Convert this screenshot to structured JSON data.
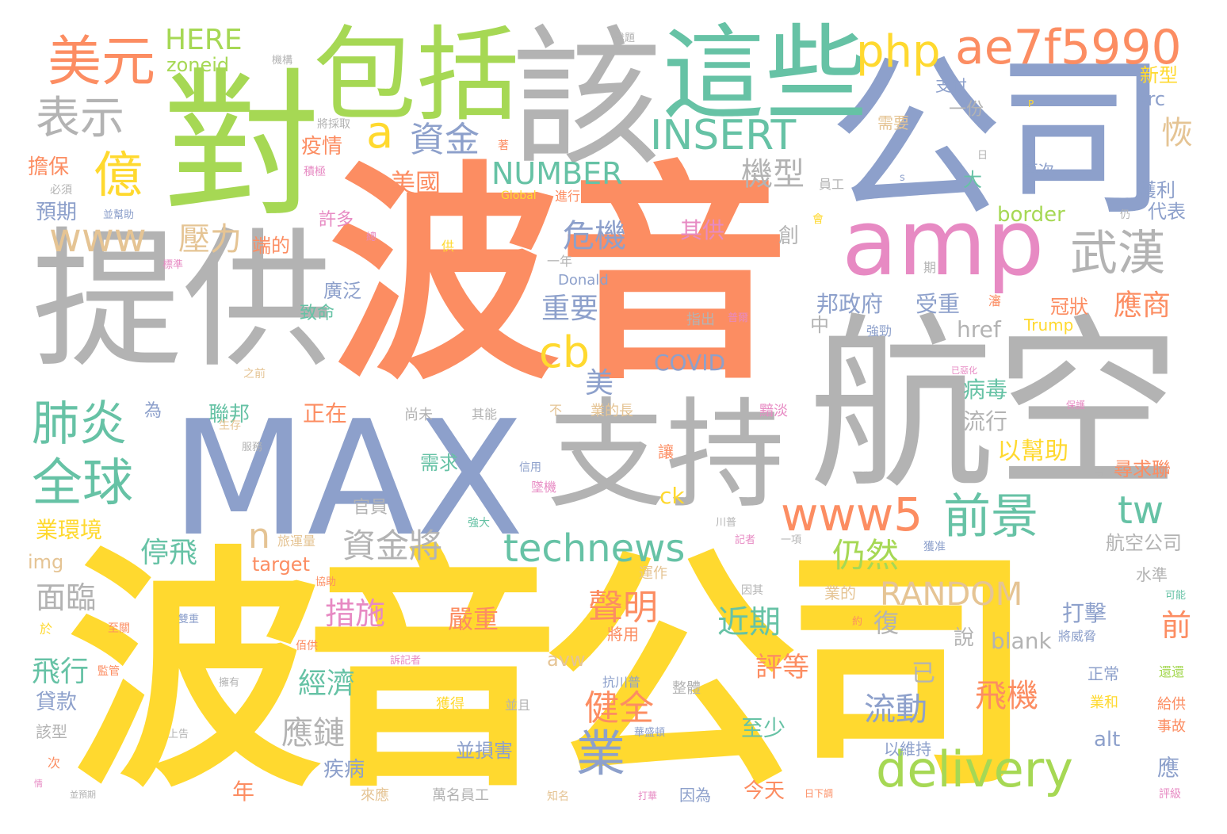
{
  "words": [
    {
      "text": "波音",
      "color": "#fc8d62"
    },
    {
      "text": "波音公司",
      "color": "#ffd92f"
    },
    {
      "text": "MAX",
      "color": "#8da0cb"
    },
    {
      "text": "航空",
      "color": "#b3b3b3"
    },
    {
      "text": "公司",
      "color": "#8da0cb"
    },
    {
      "text": "提供",
      "color": "#b3b3b3"
    },
    {
      "text": "支持",
      "color": "#b3b3b3"
    },
    {
      "text": "對",
      "color": "#a6d854"
    },
    {
      "text": "該",
      "color": "#b3b3b3"
    },
    {
      "text": "這些",
      "color": "#66c2a5"
    },
    {
      "text": "包括",
      "color": "#a6d854"
    },
    {
      "text": "amp",
      "color": "#e78ac3"
    },
    {
      "text": "美元",
      "color": "#fc8d62"
    },
    {
      "text": "php",
      "color": "#ffd92f"
    },
    {
      "text": "ae7f5990",
      "color": "#fc8d62"
    },
    {
      "text": "HERE",
      "color": "#a6d854"
    },
    {
      "text": "zoneid",
      "color": "#a6d854"
    },
    {
      "text": "表示",
      "color": "#b3b3b3"
    },
    {
      "text": "億",
      "color": "#ffd92f"
    },
    {
      "text": "a",
      "color": "#ffd92f"
    },
    {
      "text": "資金",
      "color": "#8da0cb"
    },
    {
      "text": "INSERT",
      "color": "#66c2a5"
    },
    {
      "text": "NUMBER",
      "color": "#66c2a5"
    },
    {
      "text": "機型",
      "color": "#b3b3b3"
    },
    {
      "text": "武漢",
      "color": "#b3b3b3"
    },
    {
      "text": "www",
      "color": "#e5c494"
    },
    {
      "text": "壓力",
      "color": "#e5c494"
    },
    {
      "text": "危機",
      "color": "#8da0cb"
    },
    {
      "text": "肺炎",
      "color": "#66c2a5"
    },
    {
      "text": "全球",
      "color": "#66c2a5"
    },
    {
      "text": "cb",
      "color": "#ffd92f"
    },
    {
      "text": "重要",
      "color": "#8da0cb"
    },
    {
      "text": "美國",
      "color": "#fc8d62"
    },
    {
      "text": "疫情",
      "color": "#fc8d62"
    },
    {
      "text": "www5",
      "color": "#fc8d62"
    },
    {
      "text": "前景",
      "color": "#66c2a5"
    },
    {
      "text": "tw",
      "color": "#66c2a5"
    },
    {
      "text": "technews",
      "color": "#66c2a5"
    },
    {
      "text": "n",
      "color": "#e5c494"
    },
    {
      "text": "資金將",
      "color": "#b3b3b3"
    },
    {
      "text": "停飛",
      "color": "#66c2a5"
    },
    {
      "text": "仍然",
      "color": "#a6d854"
    },
    {
      "text": "RANDOM",
      "color": "#e5c494"
    },
    {
      "text": "delivery",
      "color": "#a6d854"
    },
    {
      "text": "業",
      "color": "#8da0cb"
    },
    {
      "text": "聲明",
      "color": "#fc8d62"
    },
    {
      "text": "措施",
      "color": "#e78ac3"
    },
    {
      "text": "面臨",
      "color": "#b3b3b3"
    },
    {
      "text": "近期",
      "color": "#66c2a5"
    },
    {
      "text": "經濟",
      "color": "#66c2a5"
    },
    {
      "text": "飛機",
      "color": "#fc8d62"
    },
    {
      "text": "健全",
      "color": "#fc8d62"
    },
    {
      "text": "流動",
      "color": "#8da0cb"
    },
    {
      "text": "應鏈",
      "color": "#b3b3b3"
    },
    {
      "text": "飛行",
      "color": "#66c2a5"
    },
    {
      "text": "評等",
      "color": "#fc8d62"
    },
    {
      "text": "COVID",
      "color": "#8da0cb"
    },
    {
      "text": "應商",
      "color": "#fc8d62"
    },
    {
      "text": "邦政府",
      "color": "#8da0cb"
    },
    {
      "text": "受重",
      "color": "#8da0cb"
    },
    {
      "text": "href",
      "color": "#b3b3b3"
    },
    {
      "text": "以幫助",
      "color": "#ffd92f"
    },
    {
      "text": "病毒",
      "color": "#66c2a5"
    },
    {
      "text": "流行",
      "color": "#b3b3b3"
    },
    {
      "text": "打擊",
      "color": "#8da0cb"
    },
    {
      "text": "blank",
      "color": "#b3b3b3"
    },
    {
      "text": "嚴重",
      "color": "#fc8d62"
    },
    {
      "text": "target",
      "color": "#fc8d62"
    },
    {
      "text": "img",
      "color": "#e5c494"
    },
    {
      "text": "航空公司",
      "color": "#b3b3b3"
    },
    {
      "text": "border",
      "color": "#a6d854"
    },
    {
      "text": "獲利",
      "color": "#8da0cb"
    },
    {
      "text": "代表",
      "color": "#8da0cb"
    },
    {
      "text": "src",
      "color": "#8da0cb"
    },
    {
      "text": "新型",
      "color": "#ffd92f"
    },
    {
      "text": "支付",
      "color": "#8da0cb"
    },
    {
      "text": "一份",
      "color": "#b3b3b3"
    },
    {
      "text": "需要",
      "color": "#e5c494"
    },
    {
      "text": "再次",
      "color": "#8da0cb"
    },
    {
      "text": "其供",
      "color": "#e78ac3"
    },
    {
      "text": "擔保",
      "color": "#fc8d62"
    },
    {
      "text": "預期",
      "color": "#8da0cb"
    },
    {
      "text": "貸款",
      "color": "#8da0cb"
    },
    {
      "text": "至少",
      "color": "#66c2a5"
    },
    {
      "text": "今天",
      "color": "#fc8d62"
    },
    {
      "text": "並損害",
      "color": "#8da0cb"
    },
    {
      "text": "疾病",
      "color": "#8da0cb"
    },
    {
      "text": "年",
      "color": "#fc8d62"
    },
    {
      "text": "業環境",
      "color": "#ffd92f"
    },
    {
      "text": "官員",
      "color": "#b3b3b3"
    },
    {
      "text": "正在",
      "color": "#fc8d62"
    },
    {
      "text": "聯邦",
      "color": "#66c2a5"
    },
    {
      "text": "需求",
      "color": "#66c2a5"
    },
    {
      "text": "廣泛",
      "color": "#8da0cb"
    },
    {
      "text": "致命",
      "color": "#66c2a5"
    },
    {
      "text": "許多",
      "color": "#e78ac3"
    },
    {
      "text": "端的",
      "color": "#fc8d62"
    },
    {
      "text": "alt",
      "color": "#8da0cb"
    },
    {
      "text": "以維持",
      "color": "#8da0cb"
    },
    {
      "text": "尋求聯",
      "color": "#fc8d62"
    },
    {
      "text": "冠狀",
      "color": "#fc8d62"
    },
    {
      "text": "Trump",
      "color": "#ffd92f"
    },
    {
      "text": "Donald",
      "color": "#8da0cb"
    },
    {
      "text": "ck",
      "color": "#ffd92f"
    },
    {
      "text": "avw",
      "color": "#e5c494"
    },
    {
      "text": "說",
      "color": "#b3b3b3"
    },
    {
      "text": "已",
      "color": "#b3b3b3"
    },
    {
      "text": "復",
      "color": "#b3b3b3"
    },
    {
      "text": "美",
      "color": "#8da0cb"
    },
    {
      "text": "恢",
      "color": "#e5c494"
    },
    {
      "text": "創",
      "color": "#b3b3b3"
    },
    {
      "text": "中",
      "color": "#b3b3b3"
    },
    {
      "text": "大",
      "color": "#66c2a5"
    },
    {
      "text": "前",
      "color": "#fc8d62"
    },
    {
      "text": "應",
      "color": "#8da0cb"
    },
    {
      "text": "為",
      "color": "#8da0cb"
    },
    {
      "text": "因為",
      "color": "#8da0cb"
    },
    {
      "text": "來應",
      "color": "#e5c494"
    },
    {
      "text": "萬名員工",
      "color": "#b3b3b3"
    },
    {
      "text": "將用",
      "color": "#fc8d62"
    },
    {
      "text": "獲得",
      "color": "#ffd92f"
    },
    {
      "text": "並且",
      "color": "#b3b3b3"
    },
    {
      "text": "整體",
      "color": "#b3b3b3"
    },
    {
      "text": "運作",
      "color": "#e5c494"
    },
    {
      "text": "業的",
      "color": "#e5c494"
    },
    {
      "text": "水準",
      "color": "#b3b3b3"
    },
    {
      "text": "正常",
      "color": "#8da0cb"
    },
    {
      "text": "給供",
      "color": "#fc8d62"
    },
    {
      "text": "事故",
      "color": "#fc8d62"
    },
    {
      "text": "業和",
      "color": "#ffd92f"
    },
    {
      "text": "將威脅",
      "color": "#8da0cb"
    },
    {
      "text": "可能",
      "color": "#66c2a5"
    },
    {
      "text": "還還",
      "color": "#a6d854"
    },
    {
      "text": "評級",
      "color": "#e78ac3"
    },
    {
      "text": "Global",
      "color": "#ffd92f"
    },
    {
      "text": "進行",
      "color": "#fc8d62"
    },
    {
      "text": "員工",
      "color": "#b3b3b3"
    },
    {
      "text": "必須",
      "color": "#b3b3b3"
    },
    {
      "text": "並幫助",
      "color": "#8da0cb"
    },
    {
      "text": "積極",
      "color": "#e78ac3"
    },
    {
      "text": "將採取",
      "color": "#b3b3b3"
    },
    {
      "text": "標準",
      "color": "#e78ac3"
    },
    {
      "text": "一年",
      "color": "#b3b3b3"
    },
    {
      "text": "指出",
      "color": "#b3b3b3"
    },
    {
      "text": "普爾",
      "color": "#e78ac3"
    },
    {
      "text": "強勁",
      "color": "#8da0cb"
    },
    {
      "text": "難題",
      "color": "#b3b3b3"
    },
    {
      "text": "機構",
      "color": "#b3b3b3"
    },
    {
      "text": "尚未",
      "color": "#b3b3b3"
    },
    {
      "text": "其能",
      "color": "#b3b3b3"
    },
    {
      "text": "業的長",
      "color": "#e5c494"
    },
    {
      "text": "黯淡",
      "color": "#e78ac3"
    },
    {
      "text": "服務",
      "color": "#b3b3b3"
    },
    {
      "text": "生存",
      "color": "#e5c494"
    },
    {
      "text": "信用",
      "color": "#8da0cb"
    },
    {
      "text": "墜機",
      "color": "#e78ac3"
    },
    {
      "text": "強大",
      "color": "#66c2a5"
    },
    {
      "text": "讓",
      "color": "#fc8d62"
    },
    {
      "text": "川普",
      "color": "#b3b3b3"
    },
    {
      "text": "記者",
      "color": "#e78ac3"
    },
    {
      "text": "旅運量",
      "color": "#e5c494"
    },
    {
      "text": "一項",
      "color": "#b3b3b3"
    },
    {
      "text": "獲准",
      "color": "#8da0cb"
    },
    {
      "text": "協助",
      "color": "#fc8d62"
    },
    {
      "text": "因其",
      "color": "#b3b3b3"
    },
    {
      "text": "至關",
      "color": "#fc8d62"
    },
    {
      "text": "雙重",
      "color": "#8da0cb"
    },
    {
      "text": "佰供",
      "color": "#fc8d62"
    },
    {
      "text": "擁有",
      "color": "#b3b3b3"
    },
    {
      "text": "上告",
      "color": "#b3b3b3"
    },
    {
      "text": "抗川普",
      "color": "#8da0cb"
    },
    {
      "text": "訴記者",
      "color": "#e78ac3"
    },
    {
      "text": "監管",
      "color": "#fc8d62"
    },
    {
      "text": "於",
      "color": "#ffd92f"
    },
    {
      "text": "該型",
      "color": "#b3b3b3"
    },
    {
      "text": "次",
      "color": "#fc8d62"
    },
    {
      "text": "情",
      "color": "#e78ac3"
    },
    {
      "text": "並預期",
      "color": "#b3b3b3"
    },
    {
      "text": "華盛頓",
      "color": "#8da0cb"
    },
    {
      "text": "知名",
      "color": "#e5c494"
    },
    {
      "text": "打華",
      "color": "#e78ac3"
    },
    {
      "text": "日下調",
      "color": "#fc8d62"
    },
    {
      "text": "保護",
      "color": "#e78ac3"
    },
    {
      "text": "已惡化",
      "color": "#e78ac3"
    },
    {
      "text": "約",
      "color": "#fc8d62"
    },
    {
      "text": "萬",
      "color": "#b3b3b3"
    },
    {
      "text": "期",
      "color": "#b3b3b3"
    },
    {
      "text": "會",
      "color": "#ffd92f"
    },
    {
      "text": "總",
      "color": "#e78ac3"
    },
    {
      "text": "供",
      "color": "#ffd92f"
    },
    {
      "text": "之前",
      "color": "#e5c494"
    },
    {
      "text": "不",
      "color": "#e5c494"
    },
    {
      "text": "著",
      "color": "#fc8d62"
    },
    {
      "text": "日",
      "color": "#b3b3b3"
    },
    {
      "text": "仍",
      "color": "#b3b3b3"
    },
    {
      "text": "s",
      "color": "#8da0cb"
    },
    {
      "text": "P",
      "color": "#ffd92f"
    },
    {
      "text": "瀋",
      "color": "#fc8d62"
    }
  ]
}
